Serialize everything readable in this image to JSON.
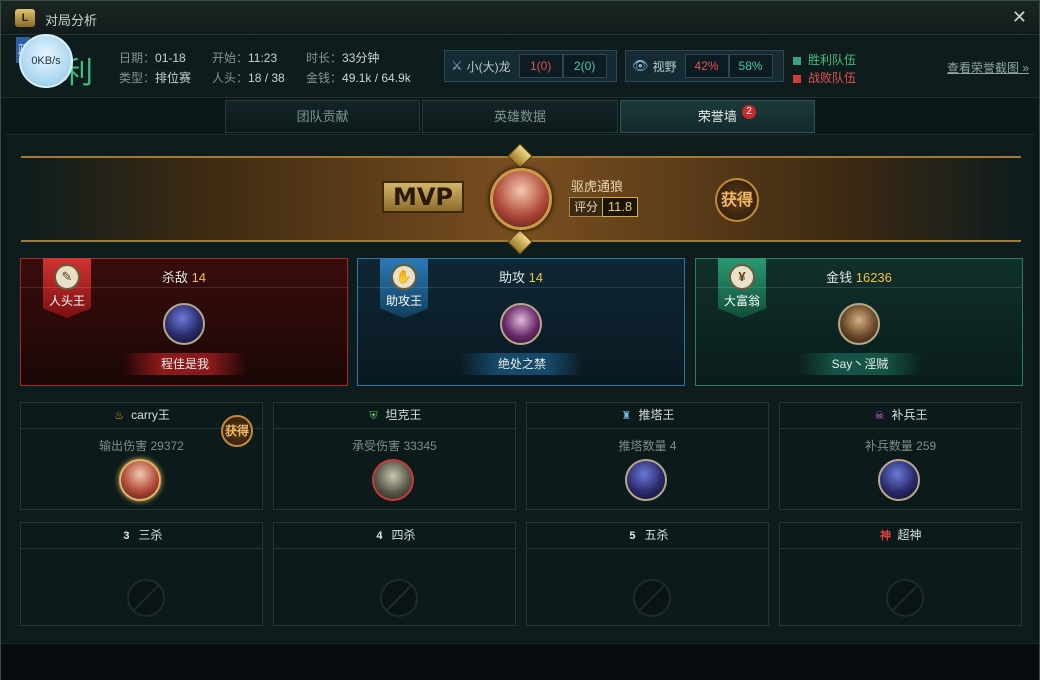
{
  "window": {
    "title": "对局分析",
    "logo": "LoL"
  },
  "summary": {
    "result": "利",
    "result_flag": "蓝",
    "speed": "0KB/s",
    "date_label": "日期：",
    "date": "01-18",
    "type_label": "类型：",
    "type": "排位赛",
    "start_label": "开始：",
    "start": "11:23",
    "kills_label": "人头：",
    "kills": "18 / 38",
    "duration_label": "时长：",
    "duration": "33分钟",
    "gold_label": "金钱：",
    "gold": "49.1k / 64.9k"
  },
  "dragon": {
    "label": "小(大)龙",
    "red": "1(0)",
    "green": "2(0)"
  },
  "vision": {
    "label": "视野",
    "red": "42%",
    "green": "58%"
  },
  "legend": {
    "win": "胜利队伍",
    "lose": "战败队伍",
    "win_color": "#3aa080",
    "lose_color": "#d43a3a"
  },
  "view_honor_link": "查看荣誉截图 »",
  "tabs": [
    {
      "label": "团队贡献",
      "active": false
    },
    {
      "label": "英雄数据",
      "active": false
    },
    {
      "label": "荣誉墙",
      "active": true,
      "badge": "2"
    }
  ],
  "mvp": {
    "tag": "MVP",
    "name": "驱虎通狼",
    "score_label": "评分",
    "score": "11.8",
    "got": "获得"
  },
  "kings": [
    {
      "title": "人头王",
      "stat_label": "杀敌",
      "stat_value": "14",
      "player": "程佳是我",
      "icon": "knife-icon"
    },
    {
      "title": "助攻王",
      "stat_label": "助攻",
      "stat_value": "14",
      "player": "绝处之禁",
      "icon": "hand-icon"
    },
    {
      "title": "大富翁",
      "stat_label": "金钱",
      "stat_value": "16236",
      "player": "Say丶淫贼",
      "icon": "yen-icon"
    }
  ],
  "awards": [
    {
      "title": "carry王",
      "sub": "输出伤害 29372",
      "got": "获得"
    },
    {
      "title": "坦克王",
      "sub": "承受伤害 33345"
    },
    {
      "title": "推塔王",
      "sub": "推塔数量 4"
    },
    {
      "title": "补兵王",
      "sub": "补兵数量 259"
    }
  ],
  "streaks": [
    {
      "title": "三杀",
      "num": "3"
    },
    {
      "title": "四杀",
      "num": "4"
    },
    {
      "title": "五杀",
      "num": "5"
    },
    {
      "title": "超神",
      "num": "神"
    }
  ]
}
